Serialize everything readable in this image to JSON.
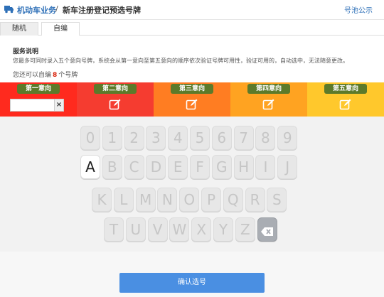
{
  "header": {
    "breadcrumb_primary": "机动车业务",
    "breadcrumb_separator": "/",
    "breadcrumb_secondary": "新车注册登记预选号牌",
    "pool_link": "号池公示"
  },
  "tabs": [
    {
      "label": "随机"
    },
    {
      "label": "自编"
    }
  ],
  "info": {
    "title": "服务说明",
    "description": "您最多可同时录入五个意向号牌，系统会从第一意向至第五意向的顺序依次验证号牌可用性，验证可用的，自动选中，无法随意更改。",
    "remain_prefix": "您还可以自编",
    "remain_count": "8",
    "remain_suffix": "个号牌"
  },
  "slots": [
    {
      "label": "第一意向",
      "color": "#ff2a1e"
    },
    {
      "label": "第二意向",
      "color": "#f53c30"
    },
    {
      "label": "第三意向",
      "color": "#ff7d22"
    },
    {
      "label": "第四意向",
      "color": "#ffa321"
    },
    {
      "label": "第五意向",
      "color": "#ffc82c"
    }
  ],
  "keyboard": {
    "row1": [
      "0",
      "1",
      "2",
      "3",
      "4",
      "5",
      "6",
      "7",
      "8",
      "9"
    ],
    "row2": [
      "A",
      "B",
      "C",
      "D",
      "E",
      "F",
      "G",
      "H",
      "I",
      "J"
    ],
    "row3": [
      "K",
      "L",
      "M",
      "N",
      "O",
      "P",
      "Q",
      "R",
      "S"
    ],
    "row4": [
      "T",
      "U",
      "V",
      "W",
      "X",
      "Y",
      "Z"
    ],
    "active_key": "A",
    "delete_icon": "backspace-icon"
  },
  "confirm_label": "确认选号",
  "colors": {
    "brand_blue": "#2d6fb7",
    "confirm_blue": "#4a8fe2",
    "label_green": "#5c7a2a"
  }
}
